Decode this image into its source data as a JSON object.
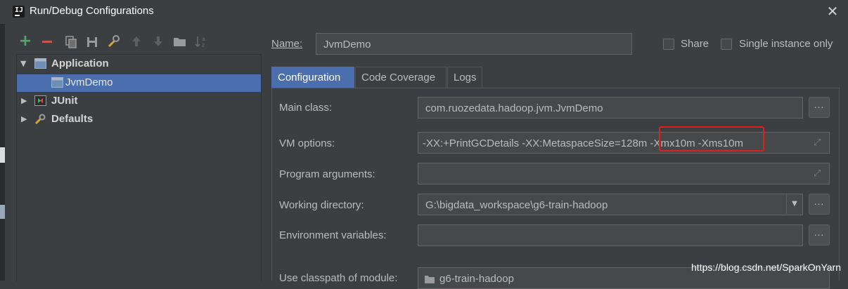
{
  "window": {
    "title": "Run/Debug Configurations",
    "close_glyph": "✕"
  },
  "toolbar": {
    "icons": [
      "add-icon",
      "remove-icon",
      "copy-icon",
      "save-icon",
      "wrench-icon",
      "move-up-icon",
      "move-down-icon",
      "folder-icon",
      "sort-icon"
    ]
  },
  "tree": {
    "application": "Application",
    "jvmdemo": "JvmDemo",
    "junit": "JUnit",
    "defaults": "Defaults"
  },
  "header": {
    "name_label": "Name:",
    "name_value": "JvmDemo",
    "share_label": "Share",
    "single_instance_label": "Single instance only"
  },
  "tabs": [
    "Configuration",
    "Code Coverage",
    "Logs"
  ],
  "form": {
    "main_class_label": "Main class:",
    "main_class_value": "com.ruozedata.hadoop.jvm.JvmDemo",
    "vm_options_label": "VM options:",
    "vm_options_value": "-XX:+PrintGCDetails -XX:MetaspaceSize=128m -Xmx10m -Xms10m",
    "program_args_label": "Program arguments:",
    "program_args_value": "",
    "working_dir_label": "Working directory:",
    "working_dir_value": "G:\\bigdata_workspace\\g6-train-hadoop",
    "env_vars_label": "Environment variables:",
    "env_vars_value": "",
    "classpath_label": "Use classpath of module:",
    "classpath_value": "g6-train-hadoop",
    "dots": "..."
  },
  "watermark": "https://blog.csdn.net/SparkOnYarn",
  "colors": {
    "background": "#3c3f41",
    "selection": "#4b6eaf",
    "highlight_box": "#e02020",
    "add_green": "#59a869",
    "remove_red": "#c75450"
  }
}
